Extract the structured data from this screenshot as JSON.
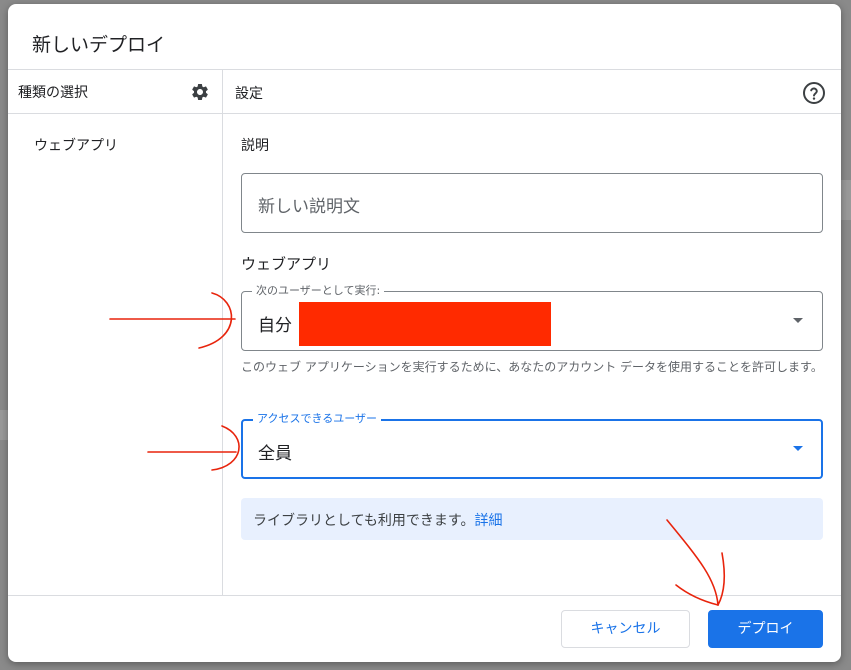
{
  "dialog": {
    "title": "新しいデプロイ"
  },
  "left_panel": {
    "header": "種類の選択",
    "header_icon": "gear-icon",
    "items": [
      {
        "label": "ウェブアプリ"
      }
    ]
  },
  "right_panel": {
    "header": "設定",
    "header_icon": "help-icon",
    "description": {
      "label": "説明",
      "placeholder": "新しい説明文"
    },
    "section_title": "ウェブアプリ",
    "execute_as": {
      "label": "次のユーザーとして実行:",
      "value": "自分",
      "helper": "このウェブ アプリケーションを実行するために、あなたのアカウント データを使用することを許可します。"
    },
    "access": {
      "label": "アクセスできるユーザー",
      "value": "全員"
    },
    "info": {
      "text": "ライブラリとしても利用できます。",
      "link": "詳細"
    }
  },
  "footer": {
    "cancel_label": "キャンセル",
    "deploy_label": "デプロイ"
  },
  "colors": {
    "accent": "#1a73e8",
    "redaction": "#ff2a00",
    "annotation": "#e8240c",
    "info_bg": "#e8f0fe"
  }
}
